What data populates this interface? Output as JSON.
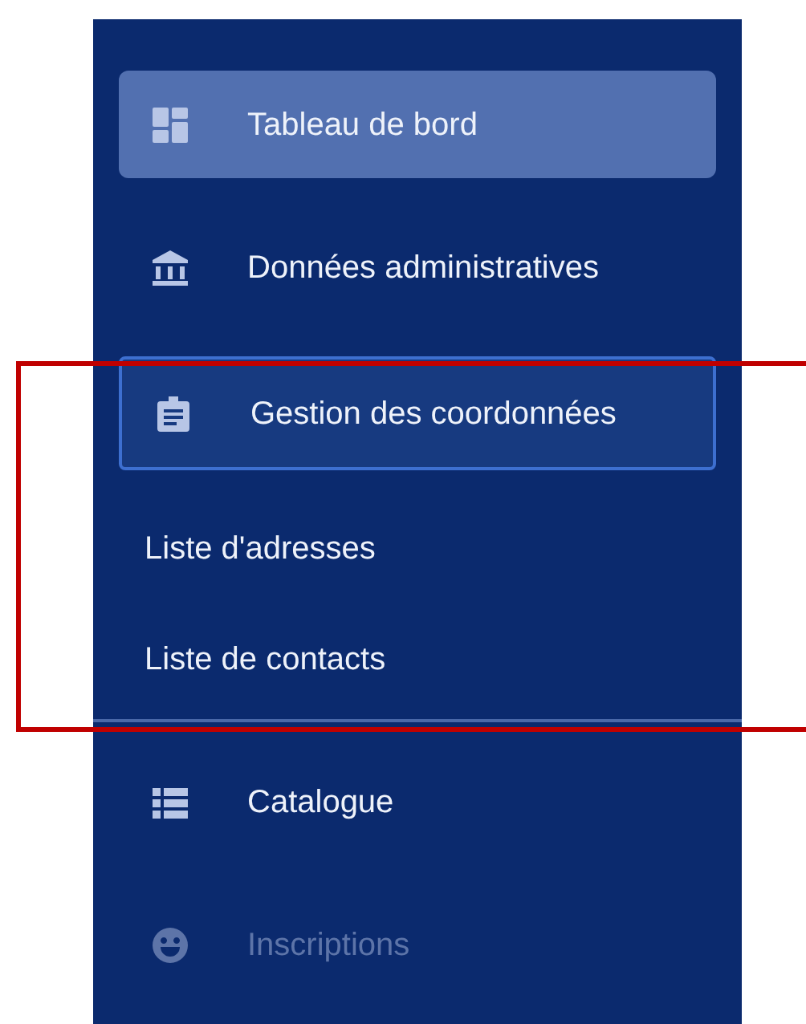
{
  "sidebar": {
    "sections": [
      {
        "items": [
          {
            "label": "Tableau de bord",
            "selected": true,
            "expanded": false,
            "disabled": false
          },
          {
            "label": "Données administratives",
            "selected": false,
            "expanded": false,
            "disabled": false
          },
          {
            "label": "Gestion des coordonnées",
            "selected": false,
            "expanded": true,
            "disabled": false,
            "children": [
              {
                "label": "Liste d'adresses"
              },
              {
                "label": "Liste de contacts"
              }
            ]
          }
        ]
      },
      {
        "items": [
          {
            "label": "Catalogue",
            "selected": false,
            "expanded": false,
            "disabled": false
          },
          {
            "label": "Inscriptions",
            "selected": false,
            "expanded": false,
            "disabled": true
          }
        ]
      }
    ]
  }
}
